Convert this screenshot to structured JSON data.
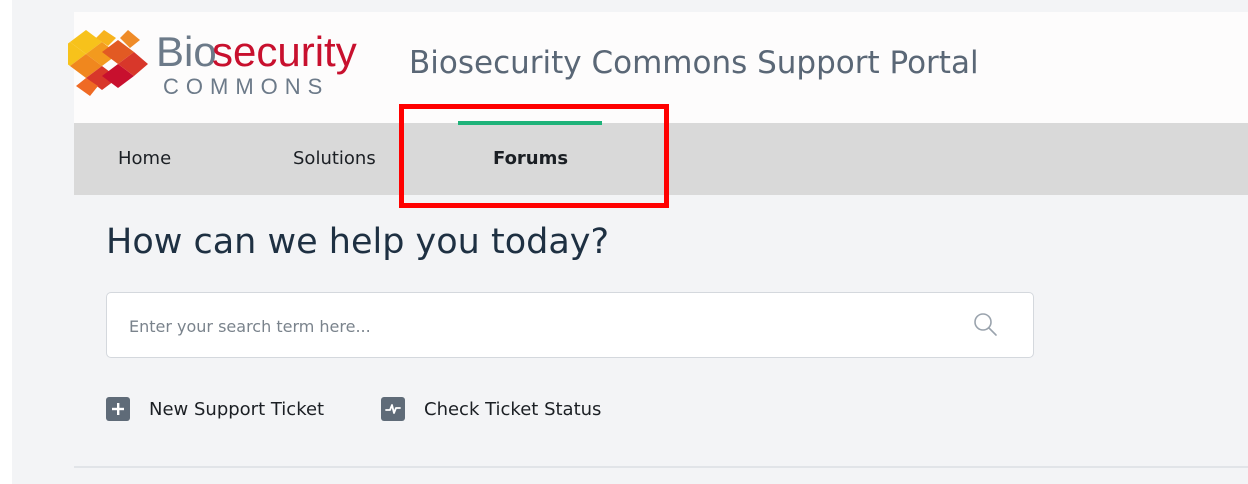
{
  "logo": {
    "text_bio": "Bio",
    "text_security": "security",
    "text_commons": "COMMONS",
    "colors": {
      "bio": "#6c7a89",
      "security": "#c8102e",
      "commons": "#6c7a89"
    }
  },
  "header": {
    "title": "Biosecurity Commons Support Portal"
  },
  "nav": {
    "items": [
      {
        "label": "Home"
      },
      {
        "label": "Solutions"
      },
      {
        "label": "Forums",
        "active": true
      }
    ],
    "active_color": "#1fb37a"
  },
  "main": {
    "heading": "How can we help you today?",
    "search": {
      "placeholder": "Enter your search term here...",
      "value": ""
    },
    "actions": [
      {
        "label": "New Support Ticket",
        "icon": "plus-icon"
      },
      {
        "label": "Check Ticket Status",
        "icon": "pulse-icon"
      }
    ]
  },
  "annotation": {
    "highlight_color": "#ff0000"
  }
}
